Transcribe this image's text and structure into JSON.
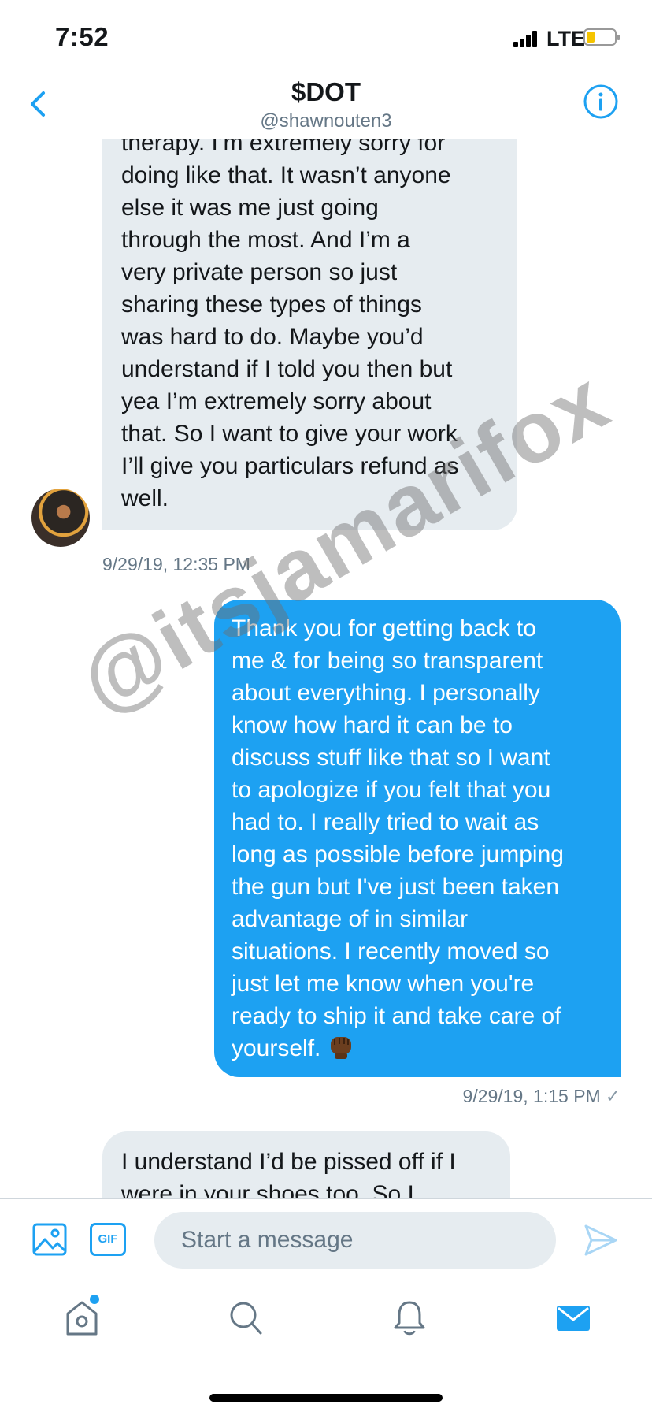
{
  "status_bar": {
    "time": "7:52",
    "network": "LTE",
    "battery_level": 0.25
  },
  "header": {
    "title": "$DOT",
    "handle": "@shawnouten3"
  },
  "messages": [
    {
      "direction": "incoming",
      "text": "therapy. I’m extremely sorry for\ndoing like that. It wasn’t anyone\nelse it was me just going\nthrough the most. And I’m a\nvery private person so just\nsharing these types of things\nwas hard to do. Maybe you’d\nunderstand if I told you then but\nyea I’m extremely sorry about\nthat. So I want to give your work\nI’ll give you particulars refund as\nwell.",
      "timestamp": "9/29/19, 12:35 PM"
    },
    {
      "direction": "outgoing",
      "text": "Thank you for getting back to\nme & for being so transparent\nabout everything. I personally\nknow how hard it can be to\ndiscuss stuff like that so I want\nto apologize if you felt that you\nhad to. I really tried to wait as\nlong as possible before jumping\nthe gun but I've just been taken\nadvantage of in similar\nsituations. I recently moved so\njust let me know when you're\nready to ship it and take care of\nyourself.",
      "emoji": "raised-fist-dark-skin-tone",
      "timestamp": "9/29/19, 1:15 PM",
      "read_mark": "✓"
    },
    {
      "direction": "incoming",
      "text": "I understand I’d be pissed off if I\nwere in your shoes too. So I"
    }
  ],
  "watermark": "@itsjamarifox",
  "composer": {
    "gif_label": "GIF",
    "placeholder": "Start a message"
  },
  "colors": {
    "accent": "#1da1f2",
    "incoming_bubble": "#e6ecf0",
    "secondary_text": "#657786"
  },
  "tabs": [
    {
      "name": "home",
      "icon": "home-icon",
      "badge_dot": true
    },
    {
      "name": "search",
      "icon": "search-icon"
    },
    {
      "name": "notifications",
      "icon": "bell-icon"
    },
    {
      "name": "messages",
      "icon": "envelope-icon",
      "active": true
    }
  ]
}
